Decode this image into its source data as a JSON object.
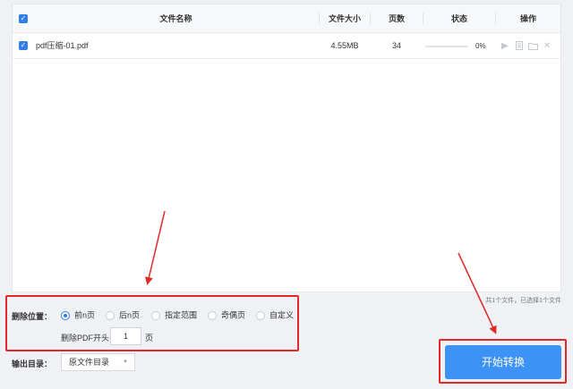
{
  "table": {
    "headers": {
      "name": "文件名称",
      "size": "文件大小",
      "pages": "页数",
      "status": "状态",
      "actions": "操作"
    },
    "rows": [
      {
        "name": "pdf压缩-01.pdf",
        "size": "4.55MB",
        "pages": "34",
        "progress_percent": 0,
        "progress_text": "0%"
      }
    ]
  },
  "selection_count": "共1个文件，已选择1个文件",
  "delete_position": {
    "label": "删除位置：",
    "options": [
      {
        "label": "前n页",
        "selected": true
      },
      {
        "label": "后n页",
        "selected": false
      },
      {
        "label": "指定范围",
        "selected": false
      },
      {
        "label": "奇偶页",
        "selected": false
      },
      {
        "label": "自定义",
        "selected": false
      }
    ],
    "prefix": "删除PDF开头",
    "value": "1",
    "suffix": "页"
  },
  "output": {
    "label": "输出目录：",
    "value": "原文件目录"
  },
  "start_button": "开始转换",
  "colors": {
    "accent": "#2f7fe6",
    "button": "#3d92f5",
    "highlight": "#e02a2a"
  },
  "icons": {
    "play": "play-icon",
    "doc": "document-icon",
    "folder": "folder-icon",
    "close": "close-icon"
  }
}
